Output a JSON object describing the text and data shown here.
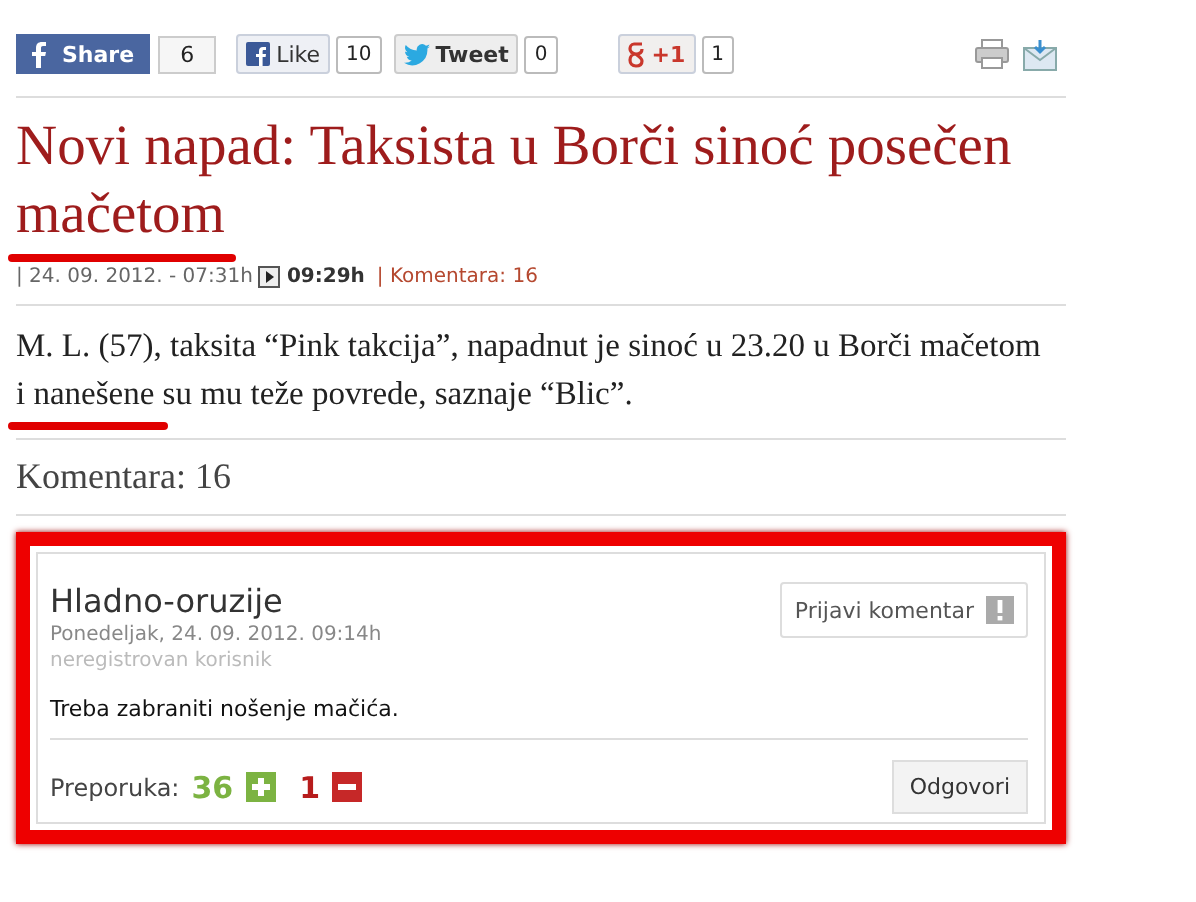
{
  "share_bar": [
    {
      "kind": "facebook-share",
      "label": "Share",
      "count": "6"
    },
    {
      "kind": "facebook-like",
      "label": "Like",
      "count": "10"
    },
    {
      "kind": "tweet",
      "label": "Tweet",
      "count": "0"
    },
    {
      "kind": "plusone",
      "label": "+1",
      "count": "1"
    }
  ],
  "article": {
    "title": "Novi napad: Taksista u Borči sinoć posečen mačetom",
    "meta": {
      "date": "| 24. 09. 2012. - 07:31h",
      "updated": "09:29h",
      "comments_link": "| Komentara: 16"
    },
    "lead": "M. L. (57), taksita “Pink takcija”, napadnut je sinoć u 23.20 u Borči mačetom i nanešene su mu teže povrede, saznaje “Blic”."
  },
  "comments_heading": "Komentara: 16",
  "comments": [
    {
      "author": "Hladno-oruzije",
      "date": "Ponedeljak, 24. 09. 2012. 09:14h",
      "user_type": "neregistrovan korisnik",
      "report_button": "Prijavi komentar",
      "text": "Treba zabraniti nošenje mačića.",
      "votes_label": "Preporuka:",
      "up": "36",
      "down": "1",
      "reply_button": "Odgovori"
    }
  ]
}
